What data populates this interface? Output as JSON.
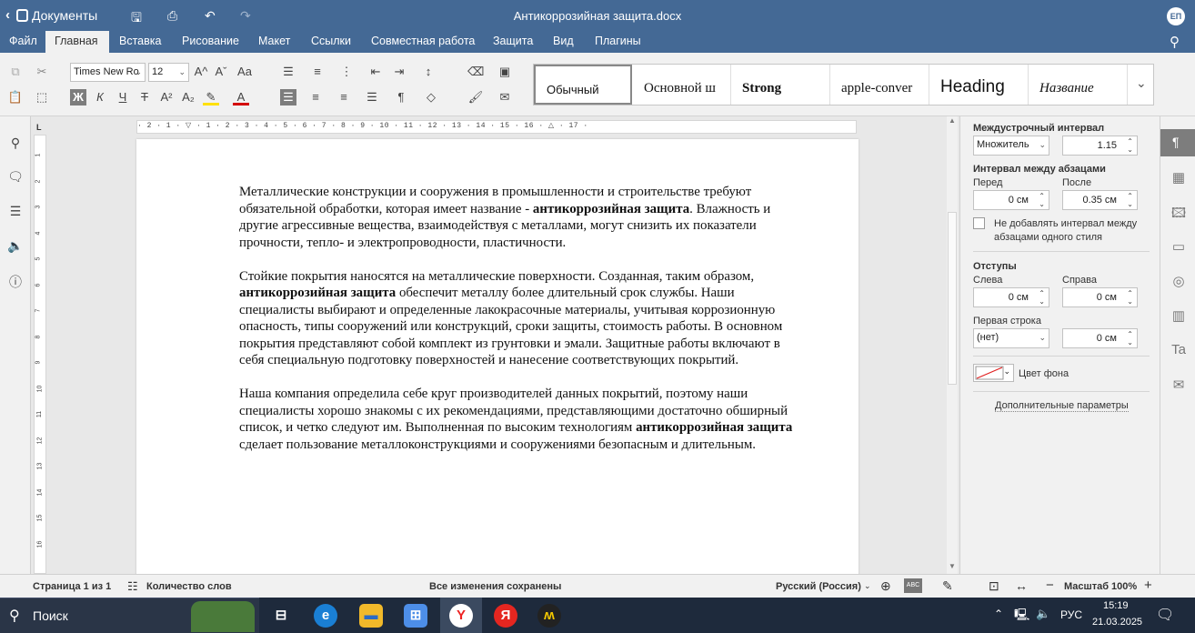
{
  "titlebar": {
    "app_name": "Документы",
    "doc_title": "Антикоррозийная защита.docx",
    "avatar": "ЕП"
  },
  "menu": {
    "tabs": [
      "Файл",
      "Главная",
      "Вставка",
      "Рисование",
      "Макет",
      "Ссылки",
      "Совместная работа",
      "Защита",
      "Вид",
      "Плагины"
    ],
    "active_tab": "Главная"
  },
  "toolbar": {
    "font_name": "Times New Ro",
    "font_size": "12",
    "bold_label": "Ж",
    "italic_label": "К",
    "underline_label": "Ч",
    "strike_label": "Т",
    "superscript_label": "A²",
    "subscript_label": "A₂",
    "grow_label": "A^",
    "shrink_label": "Aˇ",
    "case_label": "Aa",
    "styles": [
      "Обычный",
      "Основной ш",
      "Strong",
      "apple-conver",
      "Heading",
      "Название"
    ]
  },
  "ruler": {
    "h_marks": "· 2 · 1 · ▽ · 1 · 2 · 3 · 4 · 5 · 6 · 7 · 8 · 9 · 10 · 11 · 12 · 13 · 14 · 15 · 16 · △ · 17 ·",
    "v_marks": [
      "1",
      "2",
      "3",
      "4",
      "5",
      "6",
      "7",
      "8",
      "9",
      "10",
      "11",
      "12",
      "13",
      "14",
      "15",
      "16"
    ]
  },
  "document": {
    "paragraphs": [
      {
        "parts": [
          {
            "text": "Металлические конструкции и сооружения в промышленности и строительстве требуют обязательной обработки, которая имеет название - ",
            "bold": false
          },
          {
            "text": "антикоррозийная защита",
            "bold": true
          },
          {
            "text": ". Влажность и другие агрессивные вещества, взаимодействуя с металлами, могут снизить их показатели прочности, тепло- и электропроводности, пластичности.",
            "bold": false
          }
        ]
      },
      {
        "parts": [
          {
            "text": "Стойкие покрытия наносятся на металлические поверхности. Созданная, таким образом, ",
            "bold": false
          },
          {
            "text": "антикоррозийная защита",
            "bold": true
          },
          {
            "text": " обеспечит металлу более длительный срок службы. Наши специалисты выбирают и определенные лакокрасочные материалы, учитывая коррозионную опасность, типы сооружений или конструкций, сроки защиты, стоимость работы. В основном покрытия представляют собой комплект из грунтовки и эмали. Защитные работы включают в себя специальную подготовку поверхностей и нанесение соответствующих покрытий.",
            "bold": false
          }
        ]
      },
      {
        "parts": [
          {
            "text": "Наша компания определила себе круг производителей данных покрытий, поэтому наши специалисты хорошо знакомы с их рекомендациями, представляющими достаточно обширный список,  и четко следуют им. Выполненная по высоким технологиям ",
            "bold": false
          },
          {
            "text": "антикоррозийная защита",
            "bold": true
          },
          {
            "text": " сделает пользование металлоконструкциями и сооружениями безопасным и длительным.",
            "bold": false
          }
        ]
      }
    ]
  },
  "panel": {
    "line_spacing_title": "Междустрочный интервал",
    "line_spacing_mode": "Множитель",
    "line_spacing_value": "1.15",
    "para_spacing_title": "Интервал между абзацами",
    "before_label": "Перед",
    "before_value": "0 см",
    "after_label": "После",
    "after_value": "0.35 см",
    "no_space_label": "Не добавлять интервал между абзацами одного стиля",
    "indents_title": "Отступы",
    "left_label": "Слева",
    "left_value": "0 см",
    "right_label": "Справа",
    "right_value": "0 см",
    "first_line_label": "Первая строка",
    "first_line_mode": "(нет)",
    "first_line_value": "0 см",
    "bg_color_label": "Цвет фона",
    "advanced_link": "Дополнительные параметры"
  },
  "statusbar": {
    "page": "Страница 1 из 1",
    "word_count": "Количество слов",
    "saved": "Все изменения сохранены",
    "language": "Русский (Россия)",
    "zoom": "Масштаб 100%"
  },
  "taskbar": {
    "search_label": "Поиск",
    "lang": "РУС",
    "time": "15:19",
    "date": "21.03.2025"
  },
  "colors": {
    "accent": "#446995",
    "taskbar": "#1e2a3c"
  }
}
